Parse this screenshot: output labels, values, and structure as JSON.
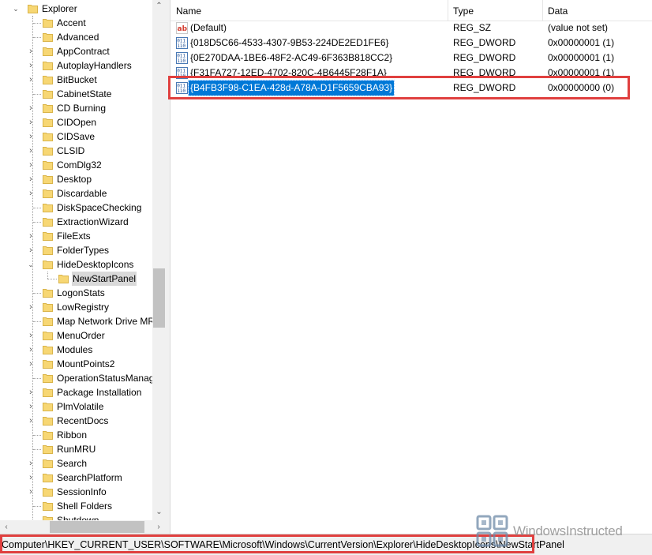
{
  "tree": {
    "parent_label": "Explorer",
    "items": [
      {
        "label": "Accent",
        "expander": false
      },
      {
        "label": "Advanced",
        "expander": false
      },
      {
        "label": "AppContract",
        "expander": true
      },
      {
        "label": "AutoplayHandlers",
        "expander": true
      },
      {
        "label": "BitBucket",
        "expander": true
      },
      {
        "label": "CabinetState",
        "expander": false
      },
      {
        "label": "CD Burning",
        "expander": true
      },
      {
        "label": "CIDOpen",
        "expander": true
      },
      {
        "label": "CIDSave",
        "expander": true
      },
      {
        "label": "CLSID",
        "expander": true
      },
      {
        "label": "ComDlg32",
        "expander": true
      },
      {
        "label": "Desktop",
        "expander": true
      },
      {
        "label": "Discardable",
        "expander": true
      },
      {
        "label": "DiskSpaceChecking",
        "expander": false
      },
      {
        "label": "ExtractionWizard",
        "expander": false
      },
      {
        "label": "FileExts",
        "expander": true
      },
      {
        "label": "FolderTypes",
        "expander": true
      },
      {
        "label": "HideDesktopIcons",
        "expander": "open"
      },
      {
        "label": "NewStartPanel",
        "expander": false,
        "child": true,
        "selected": true
      },
      {
        "label": "LogonStats",
        "expander": false
      },
      {
        "label": "LowRegistry",
        "expander": true
      },
      {
        "label": "Map Network Drive MRU",
        "expander": false
      },
      {
        "label": "MenuOrder",
        "expander": true
      },
      {
        "label": "Modules",
        "expander": true
      },
      {
        "label": "MountPoints2",
        "expander": true
      },
      {
        "label": "OperationStatusManager",
        "expander": false
      },
      {
        "label": "Package Installation",
        "expander": true
      },
      {
        "label": "PlmVolatile",
        "expander": true
      },
      {
        "label": "RecentDocs",
        "expander": true
      },
      {
        "label": "Ribbon",
        "expander": false
      },
      {
        "label": "RunMRU",
        "expander": false
      },
      {
        "label": "Search",
        "expander": true
      },
      {
        "label": "SearchPlatform",
        "expander": true
      },
      {
        "label": "SessionInfo",
        "expander": true
      },
      {
        "label": "Shell Folders",
        "expander": false
      },
      {
        "label": "Shutdown",
        "expander": false
      }
    ]
  },
  "columns": {
    "name": "Name",
    "type": "Type",
    "data": "Data"
  },
  "values": [
    {
      "icon": "string-value-icon",
      "name": "(Default)",
      "type": "REG_SZ",
      "data": "(value not set)"
    },
    {
      "icon": "dword-value-icon",
      "name": "{018D5C66-4533-4307-9B53-224DE2ED1FE6}",
      "type": "REG_DWORD",
      "data": "0x00000001 (1)"
    },
    {
      "icon": "dword-value-icon",
      "name": "{0E270DAA-1BE6-48F2-AC49-6F363B818CC2}",
      "type": "REG_DWORD",
      "data": "0x00000001 (1)"
    },
    {
      "icon": "dword-value-icon",
      "name": "{F31FA727-12ED-4702-820C-4B6445F28F1A}",
      "type": "REG_DWORD",
      "data": "0x00000001 (1)"
    },
    {
      "icon": "dword-value-icon",
      "name": "{B4FB3F98-C1EA-428d-A78A-D1F5659CBA93}",
      "type": "REG_DWORD",
      "data": "0x00000000 (0)",
      "selected": true
    }
  ],
  "statusbar": {
    "path": "Computer\\HKEY_CURRENT_USER\\SOFTWARE\\Microsoft\\Windows\\CurrentVersion\\Explorer\\HideDesktopIcons\\NewStartPanel"
  },
  "watermark": {
    "text": "WindowsInstructed"
  },
  "colors": {
    "highlight": "#e0403f",
    "selection": "#0078d7",
    "folder": "#f7d774"
  }
}
